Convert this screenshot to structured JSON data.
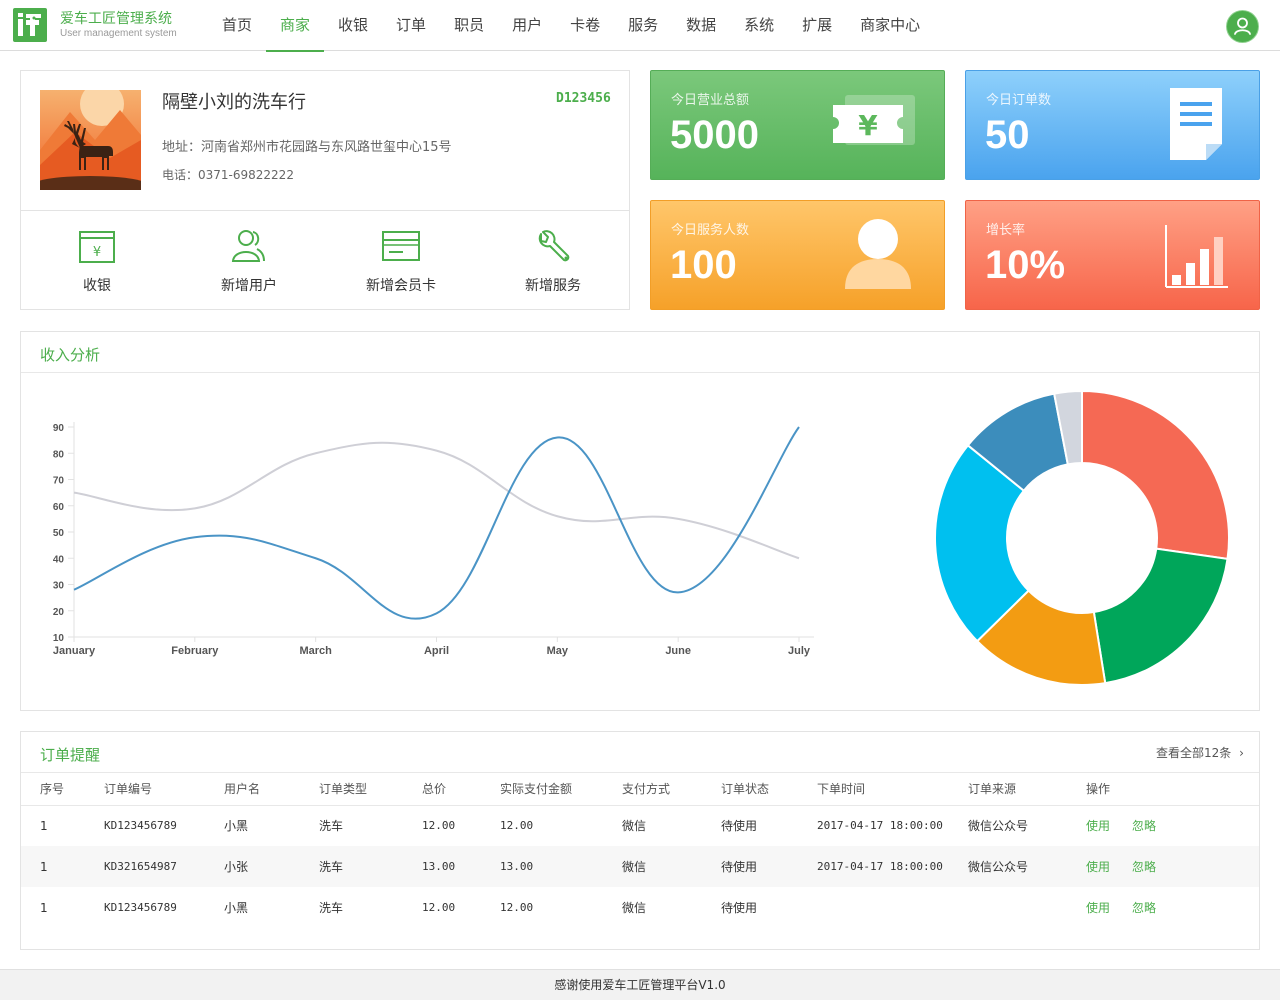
{
  "header": {
    "app_title": "爱车工匠管理系统",
    "app_subtitle": "User management system",
    "nav": [
      "首页",
      "商家",
      "收银",
      "订单",
      "职员",
      "用户",
      "卡卷",
      "服务",
      "数据",
      "系统",
      "扩展",
      "商家中心"
    ],
    "active_nav": "商家",
    "avatar_icon": "user-icon"
  },
  "store": {
    "name": "隔壁小刘的洗车行",
    "code": "D123456",
    "address": "地址：河南省郑州市花园路与东风路世玺中心15号",
    "phone": "电话：0371-69822222",
    "quick_actions": [
      {
        "label": "收银",
        "icon": "cash-register-icon"
      },
      {
        "label": "新增用户",
        "icon": "add-user-icon"
      },
      {
        "label": "新增会员卡",
        "icon": "member-card-icon"
      },
      {
        "label": "新增服务",
        "icon": "wrench-icon"
      }
    ]
  },
  "stats": {
    "revenue": {
      "label": "今日营业总额",
      "value": "5000",
      "icon": "ticket-yen-icon"
    },
    "orders": {
      "label": "今日订单数",
      "value": "50",
      "icon": "document-icon"
    },
    "served": {
      "label": "今日服务人数",
      "value": "100",
      "icon": "person-icon"
    },
    "growth": {
      "label": "增长率",
      "value": "10%",
      "icon": "bar-chart-icon"
    }
  },
  "colors": {
    "accent": "#4cae4c",
    "green_card": "#5cb85c",
    "blue_card": "#5aaaf0",
    "orange_card": "#f7a52e",
    "red_card": "#f86e52"
  },
  "income": {
    "title": "收入分析"
  },
  "chart_data": [
    {
      "type": "line",
      "categories": [
        "January",
        "February",
        "March",
        "April",
        "May",
        "June",
        "July"
      ],
      "ylim": [
        10,
        90
      ],
      "yticks": [
        10,
        20,
        30,
        40,
        50,
        60,
        70,
        80,
        90
      ],
      "grid": false,
      "series": [
        {
          "values": [
            65,
            59,
            80,
            81,
            56,
            55,
            40
          ],
          "color": "#cfcfd6"
        },
        {
          "values": [
            28,
            48,
            40,
            19,
            86,
            27,
            90
          ],
          "color": "#4a94c6"
        }
      ]
    },
    {
      "type": "pie",
      "donut": true,
      "values": [
        27,
        20,
        15,
        23,
        11,
        3
      ],
      "colors": [
        "#f56954",
        "#00a65a",
        "#f39c12",
        "#00c0ef",
        "#3c8dbc",
        "#d2d6de"
      ]
    }
  ],
  "orders": {
    "title": "订单提醒",
    "view_all": "查看全部12条",
    "columns": [
      "序号",
      "订单编号",
      "用户名",
      "订单类型",
      "总价",
      "实际支付金额",
      "支付方式",
      "订单状态",
      "下单时间",
      "订单来源",
      "操作"
    ],
    "rows": [
      {
        "no": "1",
        "order_id": "KD123456789",
        "user": "小黑",
        "type": "洗车",
        "total": "12.00",
        "paid": "12.00",
        "pay": "微信",
        "status": "待使用",
        "time": "2017-04-17 18:00:00",
        "source": "微信公众号",
        "use": "使用",
        "ignore": "忽略"
      },
      {
        "no": "1",
        "order_id": "KD321654987",
        "user": "小张",
        "type": "洗车",
        "total": "13.00",
        "paid": "13.00",
        "pay": "微信",
        "status": "待使用",
        "time": "2017-04-17 18:00:00",
        "source": "微信公众号",
        "use": "使用",
        "ignore": "忽略"
      },
      {
        "no": "1",
        "order_id": "KD123456789",
        "user": "小黑",
        "type": "洗车",
        "total": "12.00",
        "paid": "12.00",
        "pay": "微信",
        "status": "待使用",
        "time": "",
        "source": "",
        "use": "使用",
        "ignore": "忽略"
      }
    ]
  },
  "footer": "感谢使用爱车工匠管理平台V1.0"
}
